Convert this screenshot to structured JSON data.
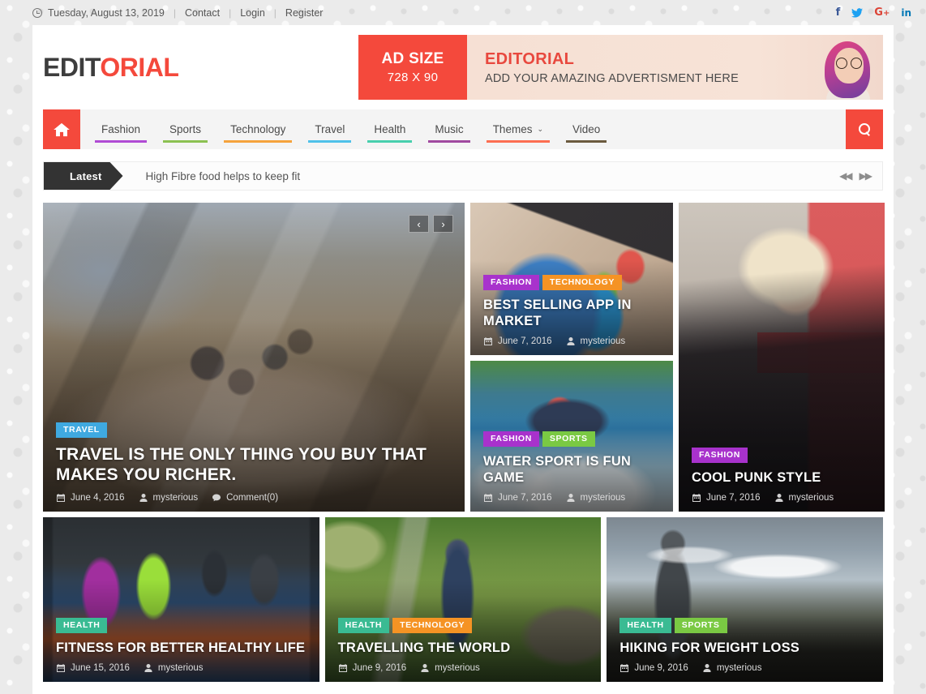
{
  "topbar": {
    "clock_icon": "clock-icon",
    "date": "Tuesday, August 13, 2019",
    "separator": "|",
    "links": [
      {
        "label": "Contact"
      },
      {
        "label": "Login"
      },
      {
        "label": "Register"
      }
    ],
    "social": [
      {
        "name": "facebook-icon",
        "glyph": "f",
        "color": "#3b5998"
      },
      {
        "name": "twitter-icon",
        "glyph": "🐦",
        "color": "#1da1f2"
      },
      {
        "name": "google-plus-icon",
        "glyph": "G+",
        "color": "#db4437"
      },
      {
        "name": "linkedin-icon",
        "glyph": "in",
        "color": "#0077b5"
      }
    ]
  },
  "header": {
    "logo_first": "EDIT",
    "logo_second": "ORIAL",
    "logo_color_first": "#3d3d3d",
    "logo_color_second": "#f4493c",
    "ad": {
      "size_label": "AD SIZE",
      "dimensions": "728 X 90",
      "brand": "EDITORIAL",
      "tagline": "ADD YOUR AMAZING ADVERTISMENT HERE",
      "left_bg": "#f4493c",
      "right_bg": "#f6e0d4"
    }
  },
  "nav": {
    "home_icon": "home-icon",
    "search_icon": "search-icon",
    "items": [
      {
        "label": "Fashion",
        "color": "#b04bd4"
      },
      {
        "label": "Sports",
        "color": "#8cc152"
      },
      {
        "label": "Technology",
        "color": "#f5a33c"
      },
      {
        "label": "Travel",
        "color": "#4fc1e9"
      },
      {
        "label": "Health",
        "color": "#48cfad"
      },
      {
        "label": "Music",
        "color": "#a0499f"
      },
      {
        "label": "Themes",
        "color": "#fc6e51",
        "has_dropdown": true,
        "caret": "⌄"
      },
      {
        "label": "Video",
        "color": "#6b5a3e"
      }
    ]
  },
  "ticker": {
    "label": "Latest",
    "headline": "High Fibre food helps to keep fit",
    "prev_icon": "double-arrow-left-icon",
    "next_icon": "double-arrow-right-icon",
    "prev_glyph": "◀◀",
    "next_glyph": "▶▶"
  },
  "slider": {
    "prev_label": "‹",
    "next_label": "›"
  },
  "category_colors": {
    "TRAVEL": "#3fa9e0",
    "FASHION": "#a832cc",
    "TECHNOLOGY": "#f59324",
    "SPORTS": "#7ac943",
    "HEALTH": "#3abb93"
  },
  "cards": [
    {
      "key": "hero",
      "categories": [
        "TRAVEL"
      ],
      "title": "TRAVEL IS THE ONLY THING YOU BUY THAT MAKES YOU RICHER.",
      "date": "June 4, 2016",
      "author": "mysterious",
      "comments": "Comment(0)"
    },
    {
      "key": "app",
      "categories": [
        "FASHION",
        "TECHNOLOGY"
      ],
      "title": "BEST SELLING APP IN MARKET",
      "date": "June 7, 2016",
      "author": "mysterious"
    },
    {
      "key": "water",
      "categories": [
        "FASHION",
        "SPORTS"
      ],
      "title": "WATER SPORT IS FUN GAME",
      "date": "June 7, 2016",
      "author": "mysterious"
    },
    {
      "key": "punk",
      "categories": [
        "FASHION"
      ],
      "title": "COOL PUNK STYLE",
      "date": "June 7, 2016",
      "author": "mysterious"
    },
    {
      "key": "fitness",
      "categories": [
        "HEALTH"
      ],
      "title": "FITNESS FOR BETTER HEALTHY LIFE",
      "date": "June 15, 2016",
      "author": "mysterious"
    },
    {
      "key": "travelling",
      "categories": [
        "HEALTH",
        "TECHNOLOGY"
      ],
      "title": "TRAVELLING THE WORLD",
      "date": "June 9, 2016",
      "author": "mysterious"
    },
    {
      "key": "hiking",
      "categories": [
        "HEALTH",
        "SPORTS"
      ],
      "title": "HIKING FOR WEIGHT LOSS",
      "date": "June 9, 2016",
      "author": "mysterious"
    }
  ],
  "meta_icons": {
    "date": "calendar-icon",
    "author": "user-icon",
    "comments": "comment-icon"
  }
}
